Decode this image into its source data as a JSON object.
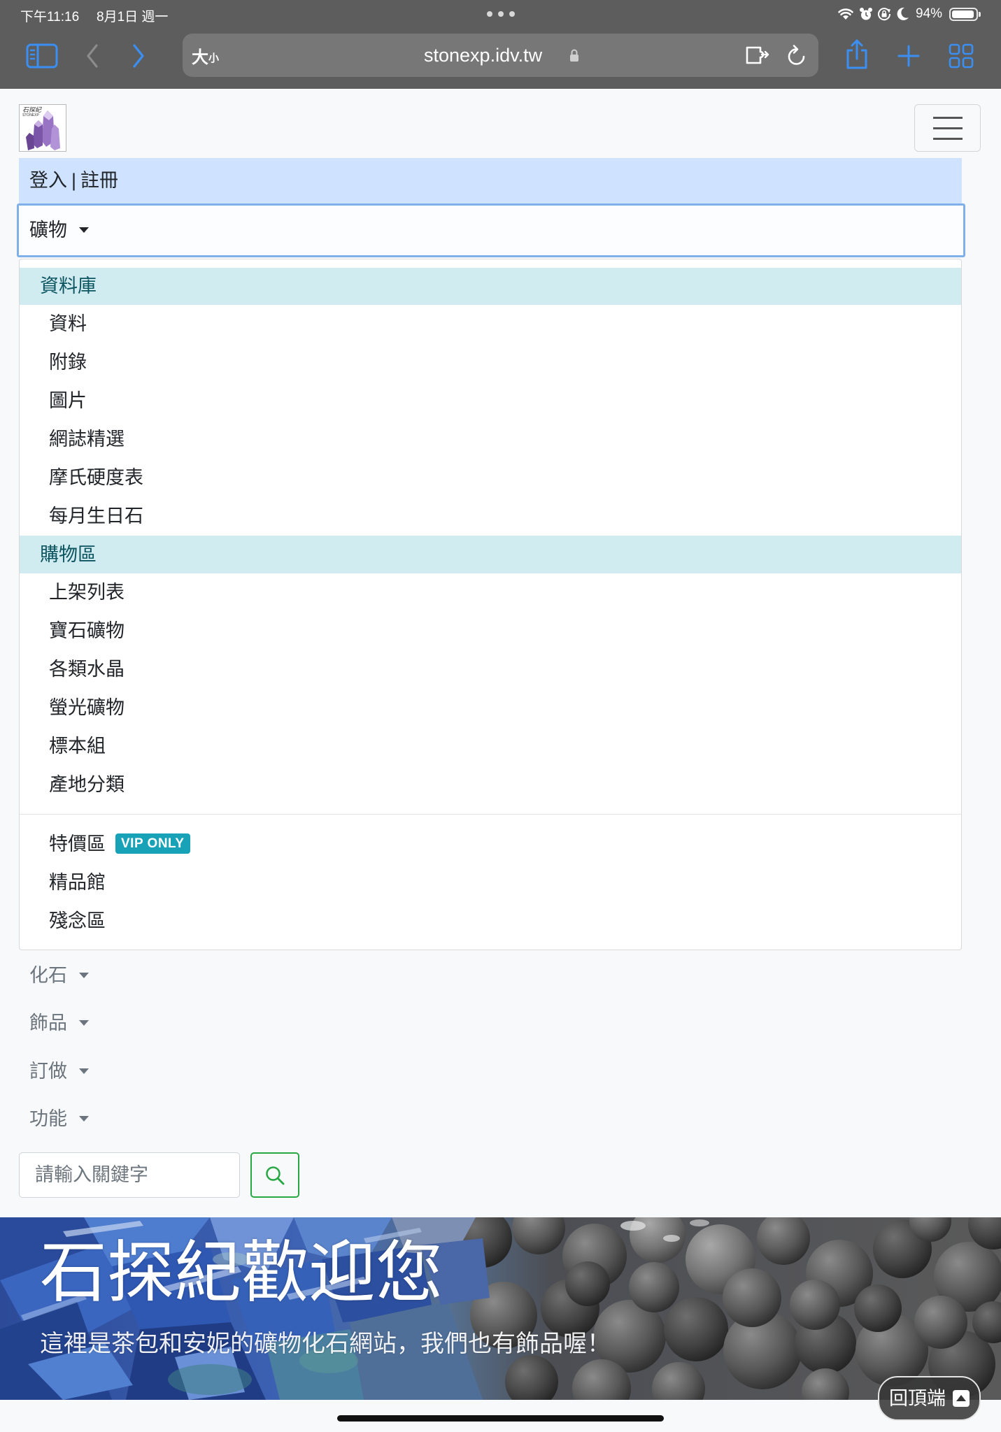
{
  "status_bar": {
    "time": "下午11:16",
    "date": "8月1日 週一",
    "battery": "94%",
    "battery_level": 0.94
  },
  "browser": {
    "text_size_large": "大",
    "text_size_small": "小",
    "url": "stonexp.idv.tw",
    "back_enabled": false,
    "forward_enabled": true
  },
  "site": {
    "logo": {
      "name": "石探紀",
      "subname": "STONEXP"
    },
    "auth": {
      "login": "登入",
      "separator": "|",
      "register": "註冊"
    },
    "nav": {
      "minerals": {
        "label": "礦物",
        "open": true,
        "sections": [
          {
            "header": "資料庫",
            "items": [
              "資料",
              "附錄",
              "圖片",
              "網誌精選",
              "摩氏硬度表",
              "每月生日石"
            ]
          },
          {
            "header": "購物區",
            "items": [
              "上架列表",
              "寶石礦物",
              "各類水晶",
              "螢光礦物",
              "標本組",
              "產地分類"
            ]
          }
        ],
        "extra_items": [
          {
            "label": "特價區",
            "badge": "VIP ONLY"
          },
          {
            "label": "精品館"
          },
          {
            "label": "殘念區"
          }
        ]
      },
      "other_menus": [
        {
          "label": "化石"
        },
        {
          "label": "飾品"
        },
        {
          "label": "訂做"
        },
        {
          "label": "功能"
        }
      ]
    },
    "search": {
      "placeholder": "請輸入關鍵字",
      "value": ""
    },
    "hero": {
      "title": "石探紀歡迎您",
      "subtitle": "這裡是茶包和安妮的礦物化石網站，我們也有飾品喔！"
    },
    "back_to_top": "回頂端"
  },
  "icons": {
    "toolbar": [
      "sidebar-icon",
      "back-chevron-icon",
      "forward-chevron-icon",
      "extension-icon",
      "reload-icon",
      "share-icon",
      "plus-icon",
      "tabs-grid-icon"
    ],
    "status": [
      "wifi-icon",
      "alarm-icon",
      "rotation-lock-icon",
      "moon-icon",
      "battery-icon"
    ],
    "page": [
      "hamburger-menu-icon",
      "search-icon",
      "arrow-up-icon"
    ]
  },
  "colors": {
    "browser_accent": "#3b8ff2",
    "auth_bar_bg": "#cfe2ff",
    "section_header_bg": "#d1ecf1",
    "section_header_text": "#0c5460",
    "badge_bg": "#17a2b8",
    "search_button": "#28a745"
  }
}
